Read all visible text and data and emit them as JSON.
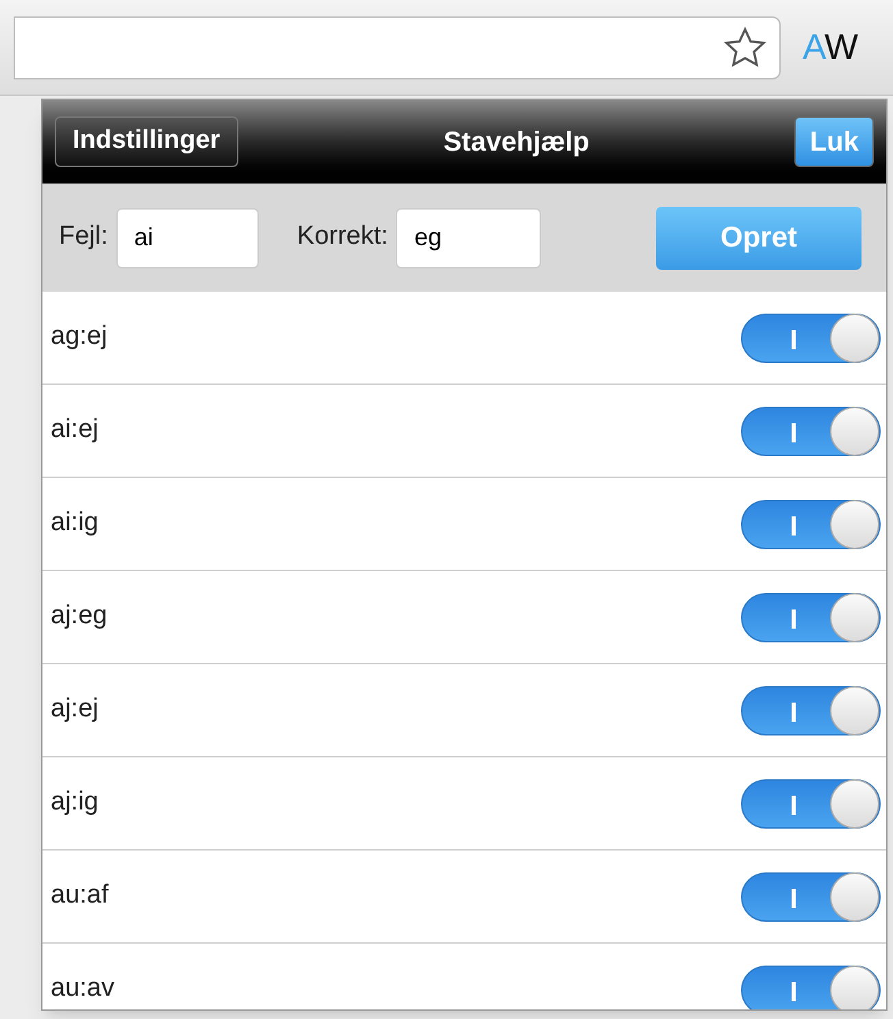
{
  "toolbar": {
    "logo": [
      {
        "text": "A",
        "color": "#3ba3e8"
      },
      {
        "text": "W",
        "color": "#111111"
      }
    ]
  },
  "popup": {
    "settings_button": "Indstillinger",
    "title": "Stavehjælp",
    "close_button": "Luk",
    "form": {
      "error_label": "Fejl:",
      "error_value": "ai",
      "correct_label": "Korrekt:",
      "correct_value": "eg",
      "create_button": "Opret"
    },
    "rules": [
      {
        "label": "ag:ej",
        "on": true
      },
      {
        "label": "ai:ej",
        "on": true
      },
      {
        "label": "ai:ig",
        "on": true
      },
      {
        "label": "aj:eg",
        "on": true
      },
      {
        "label": "aj:ej",
        "on": true
      },
      {
        "label": "aj:ig",
        "on": true
      },
      {
        "label": "au:af",
        "on": true
      },
      {
        "label": "au:av",
        "on": true
      }
    ]
  }
}
